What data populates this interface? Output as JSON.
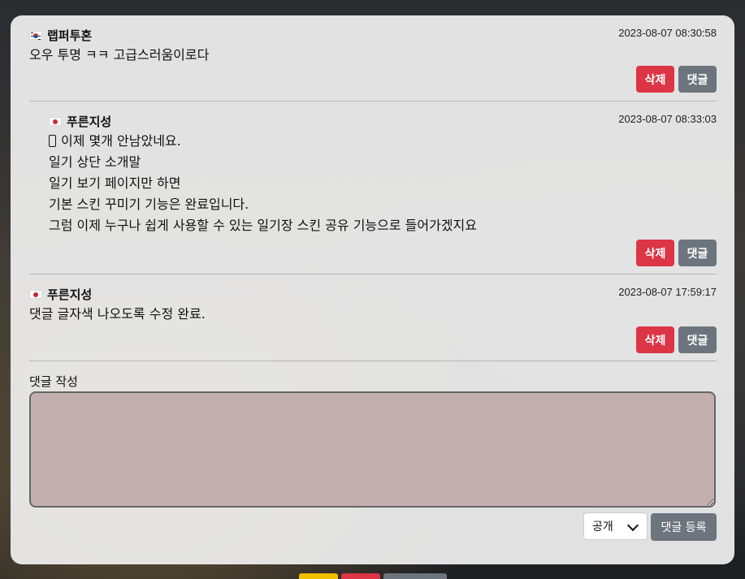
{
  "comments": [
    {
      "author": "랩퍼투혼",
      "flag": "kr",
      "time": "2023-08-07 08:30:58",
      "lines": [
        "오우 투명 ㅋㅋ 고급스러움이로다"
      ],
      "delete_label": "삭제",
      "reply_label": "댓글"
    },
    {
      "author": "푸른지성",
      "flag": "jp",
      "time": "2023-08-07 08:33:03",
      "lines": [
        "이제 몇개 안남았네요.",
        "일기 상단 소개말",
        "일기 보기 페이지만 하면",
        "기본 스킨 꾸미기 기능은 완료입니다.",
        "그럼 이제 누구나 쉽게 사용할 수 있는 일기장 스킨 공유 기능으로 들어가겠지요"
      ],
      "delete_label": "삭제",
      "reply_label": "댓글"
    },
    {
      "author": "푸른지성",
      "flag": "jp",
      "time": "2023-08-07 17:59:17",
      "lines": [
        "댓글 글자색 나오도록 수정 완료."
      ],
      "delete_label": "삭제",
      "reply_label": "댓글"
    }
  ],
  "write": {
    "label": "댓글 작성",
    "textarea_value": "",
    "visibility_selected": "공개",
    "submit_label": "댓글 등록"
  },
  "colors": {
    "delete": "#dc3545",
    "reply": "#6c757d",
    "textarea_bg": "#c4afaf"
  }
}
